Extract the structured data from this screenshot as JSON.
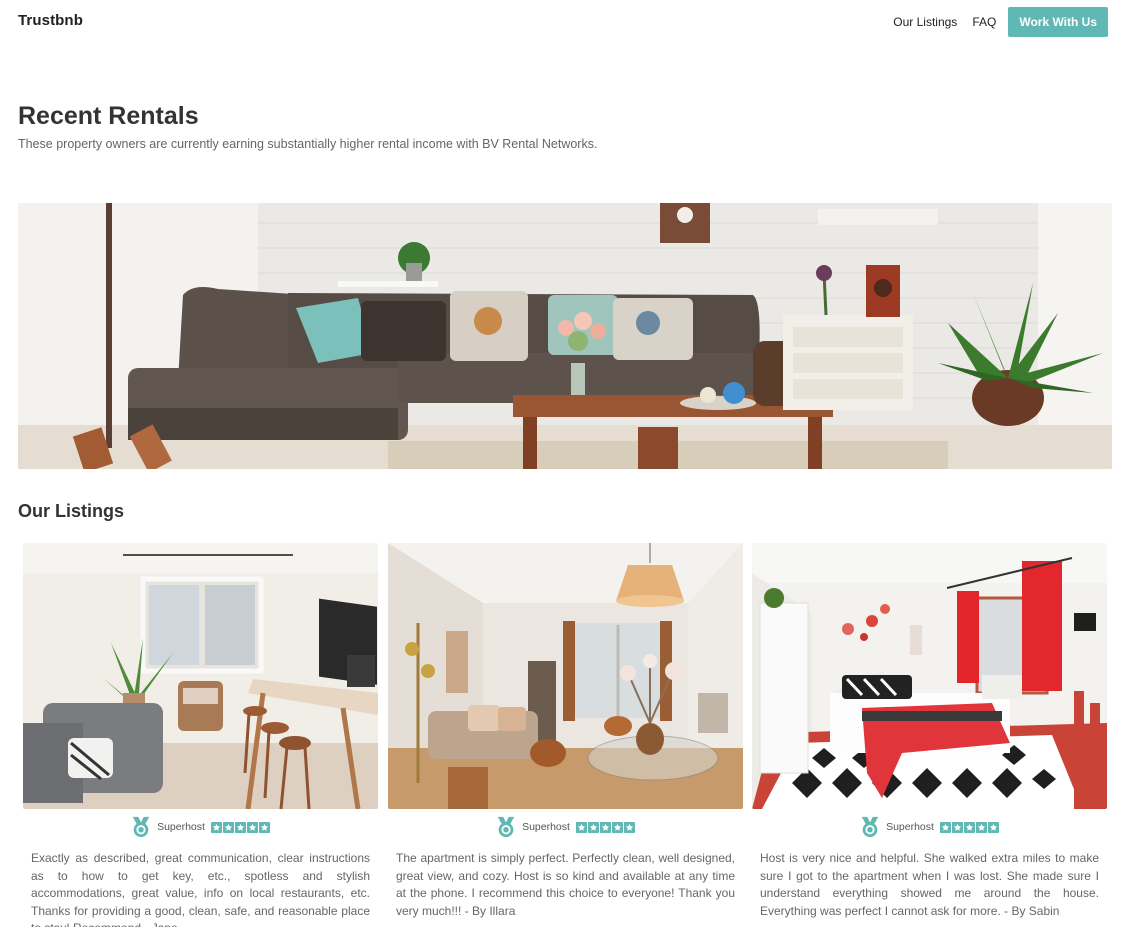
{
  "brand": "Trustbnb",
  "nav": {
    "listings": "Our Listings",
    "faq": "FAQ",
    "cta": "Work With Us"
  },
  "hero": {
    "title": "Recent Rentals",
    "subtitle": "These property owners are currently earning substantially higher rental income with BV Rental Networks."
  },
  "section_title": "Our Listings",
  "colors": {
    "accent": "#5fb8b3",
    "text": "#333333",
    "muted": "#666666"
  },
  "listings": [
    {
      "badge": "Superhost",
      "rating": 5,
      "review": "Exactly as described, great communication, clear instructions as to how to get key, etc., spotless and stylish accommodations, great value, info on local restaurants, etc. Thanks for providing a good, clean, safe, and reasonable place to stay! Recommend.- Jane"
    },
    {
      "badge": "Superhost",
      "rating": 5,
      "review": "The apartment is simply perfect. Perfectly clean, well designed, great view, and cozy. Host is so kind and available at any time at the phone. I recommend this choice to everyone! Thank you very much!!! - By Illara"
    },
    {
      "badge": "Superhost",
      "rating": 5,
      "review": "Host is very nice and helpful. She walked extra miles to make sure I got to the apartment when I was lost. She made sure I understand everything showed me around the house. Everything was perfect I cannot ask for more. - By Sabin"
    }
  ]
}
